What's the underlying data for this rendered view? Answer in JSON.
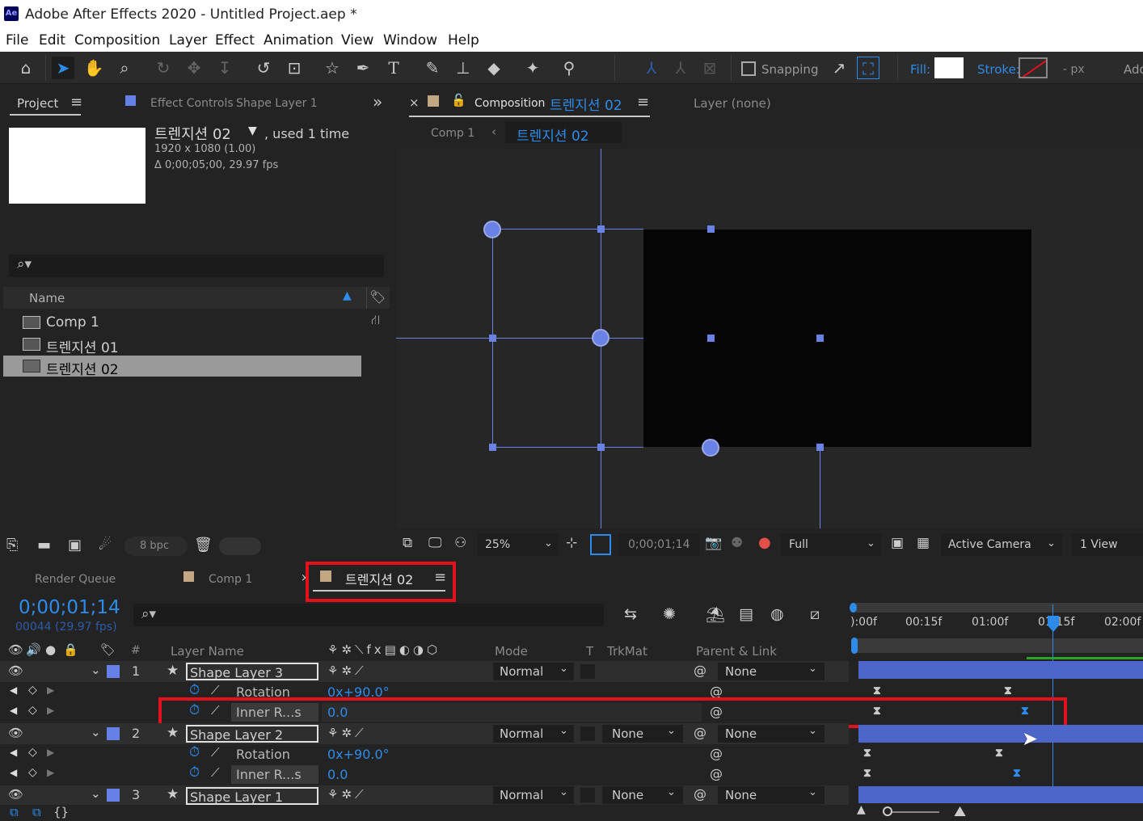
{
  "app": {
    "logo": "Ae",
    "title": "Adobe After Effects 2020 - Untitled Project.aep *"
  },
  "menu": [
    "File",
    "Edit",
    "Composition",
    "Layer",
    "Effect",
    "Animation",
    "View",
    "Window",
    "Help"
  ],
  "toolbar": {
    "snapping_label": "Snapping",
    "fill_label": "Fill:",
    "stroke_label": "Stroke:",
    "px_label": "- px",
    "add_label": "Add"
  },
  "project_panel": {
    "tab_project": "Project",
    "tab_effect_controls": "Effect Controls",
    "effect_controls_target": "Shape Layer 1",
    "selected_name": "트렌지션 02",
    "used_text": ", used 1 time",
    "dimensions": "1920 x 1080 (1.00)",
    "duration": "Δ 0;00;05;00, 29.97 fps",
    "column_name": "Name",
    "items": [
      "Comp 1",
      "트렌지션 01",
      "트렌지션 02"
    ],
    "bpc": "8 bpc"
  },
  "viewer": {
    "tab_composition": "Composition",
    "comp_name": "트렌지션 02",
    "tab_layer": "Layer (none)",
    "breadcrumb_parent": "Comp 1",
    "breadcrumb_current": "트렌지션 02",
    "zoom": "25%",
    "timecode": "0;00;01;14",
    "resolution": "Full",
    "camera": "Active Camera",
    "views": "1 View"
  },
  "timeline": {
    "tab_render_queue": "Render Queue",
    "tab_comp1": "Comp 1",
    "tab_active": "트렌지션 02",
    "current_time": "0;00;01;14",
    "frame_info": "00044 (29.97 fps)",
    "ruler": [
      "):00f",
      "00:15f",
      "01:00f",
      "01:15f",
      "02:00f"
    ],
    "columns": {
      "hash": "#",
      "layer_name": "Layer Name",
      "mode": "Mode",
      "t": "T",
      "trkmat": "TrkMat",
      "parent": "Parent & Link"
    },
    "layers": [
      {
        "num": "1",
        "name": "Shape Layer 3",
        "mode": "Normal",
        "trkmat": "",
        "parent": "None",
        "props": [
          {
            "name": "Rotation",
            "value": "0x+90.0°"
          },
          {
            "name": "Inner R...s",
            "value": "0.0"
          }
        ]
      },
      {
        "num": "2",
        "name": "Shape Layer 2",
        "mode": "Normal",
        "trkmat": "None",
        "parent": "None",
        "props": [
          {
            "name": "Rotation",
            "value": "0x+90.0°"
          },
          {
            "name": "Inner R...s",
            "value": "0.0"
          }
        ]
      },
      {
        "num": "3",
        "name": "Shape Layer 1",
        "mode": "Normal",
        "trkmat": "None",
        "parent": "None",
        "props": []
      }
    ]
  },
  "colors": {
    "accent": "#2d8ceb",
    "layer_label": "#6680e8",
    "bar": "#4d66c9",
    "highlight": "#e3101e",
    "comp_swatch": "#c2a782"
  }
}
